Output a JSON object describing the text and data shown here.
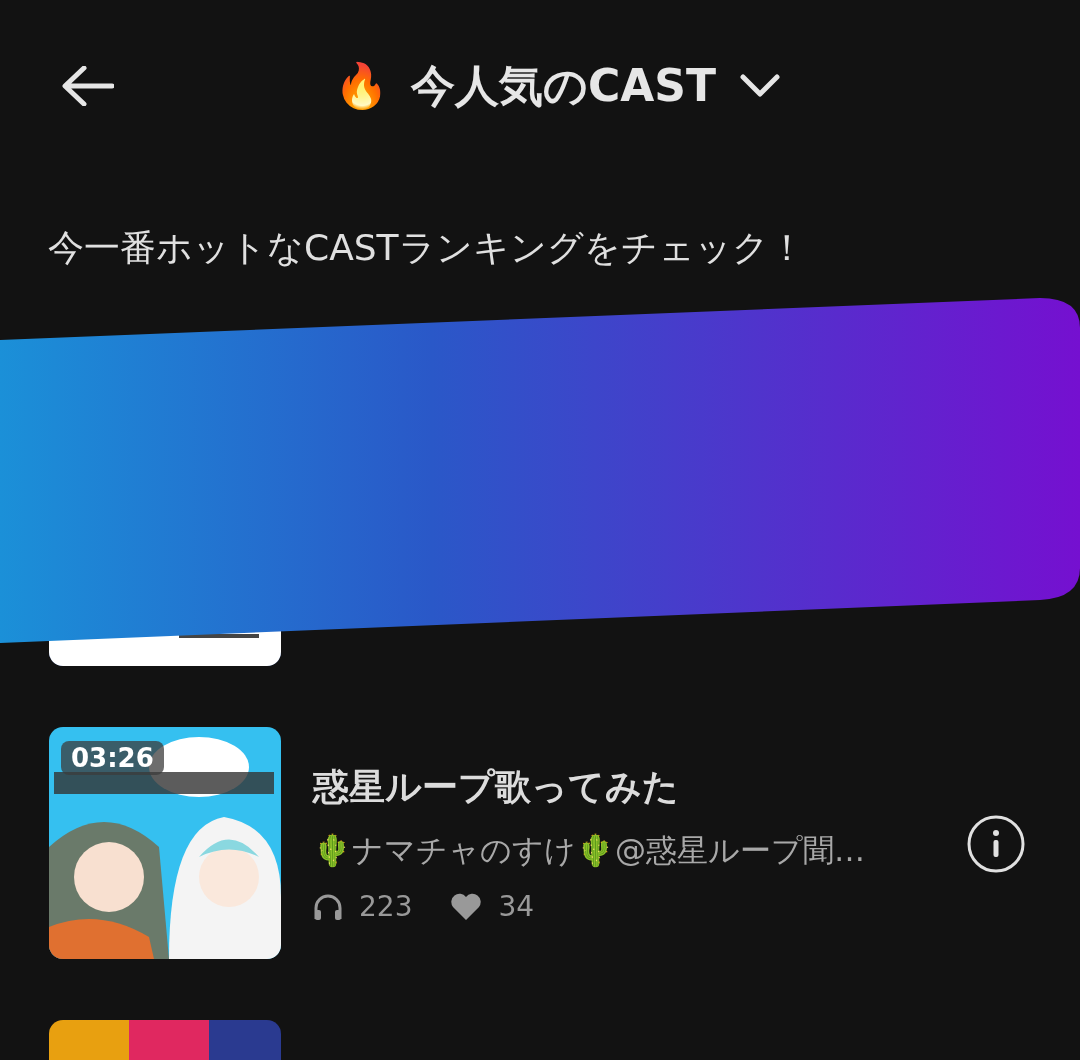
{
  "header": {
    "title_icon": "🔥",
    "title": "今人気のCAST"
  },
  "subtitle": "今一番ホットなCASTランキングをチェック！",
  "casts": [
    {
      "kind": "covered"
    },
    {
      "kind": "full",
      "duration": "03:26",
      "title": "惑星ループ歌ってみた",
      "author": "🌵ナマチャのすけ🌵@惑星ループ聞…",
      "plays": "223",
      "likes": "34"
    },
    {
      "kind": "cut"
    }
  ]
}
